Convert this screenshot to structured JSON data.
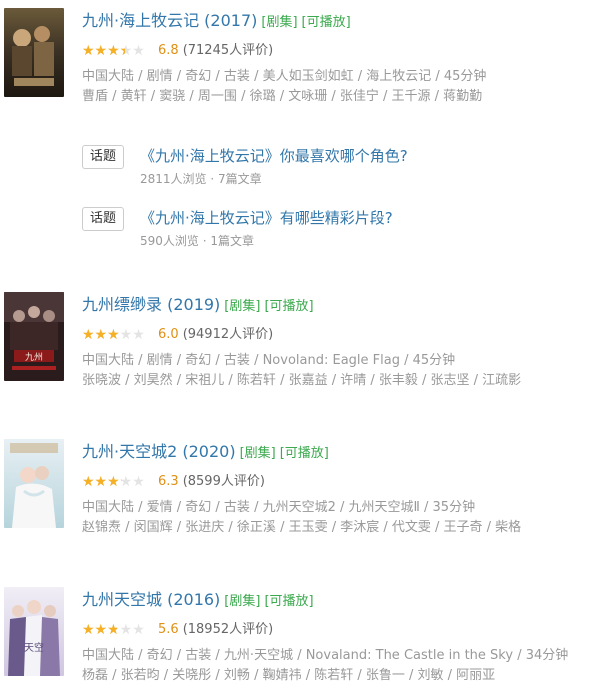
{
  "colors": {
    "link": "#3377aa",
    "tag_green": "#3ba94d",
    "star_gold": "#f5b025",
    "score_orange": "#e09015",
    "meta_gray": "#999999"
  },
  "items": [
    {
      "title": "九州·海上牧云记 (2017)",
      "tags": [
        "[剧集]",
        "[可播放]"
      ],
      "rating_fraction": 0.68,
      "score": "6.8",
      "votes": "(71245人评价)",
      "meta1": "中国大陆 / 剧情 / 奇幻 / 古装 / 美人如玉剑如虹 / 海上牧云记 / 45分钟",
      "meta2": "曹盾 / 黄轩 / 窦骁 / 周一围 / 徐璐 / 文咏珊 / 张佳宁 / 王千源 / 蒋勤勤",
      "topics": [
        {
          "button": "话题",
          "title": "《九州·海上牧云记》你最喜欢哪个角色?",
          "sub": "2811人浏览 · 7篇文章"
        },
        {
          "button": "话题",
          "title": "《九州·海上牧云记》有哪些精彩片段?",
          "sub": "590人浏览 · 1篇文章"
        }
      ]
    },
    {
      "title": "九州缥缈录 (2019)",
      "tags": [
        "[剧集]",
        "[可播放]"
      ],
      "rating_fraction": 0.6,
      "score": "6.0",
      "votes": "(94912人评价)",
      "meta1": "中国大陆 / 剧情 / 奇幻 / 古装 / Novoland: Eagle Flag / 45分钟",
      "meta2": "张晓波 / 刘昊然 / 宋祖儿 / 陈若轩 / 张嘉益 / 许晴 / 张丰毅 / 张志坚 / 江疏影"
    },
    {
      "title": "九州·天空城2 (2020)",
      "tags": [
        "[剧集]",
        "[可播放]"
      ],
      "rating_fraction": 0.63,
      "score": "6.3",
      "votes": "(8599人评价)",
      "meta1": "中国大陆 / 爱情 / 奇幻 / 古装 / 九州天空城2 / 九州天空城Ⅱ / 35分钟",
      "meta2": "赵锦焘 / 闵国辉 / 张进庆 / 徐正溪 / 王玉雯 / 李沐宸 / 代文雯 / 王子奇 / 柴格"
    },
    {
      "title": "九州天空城 (2016)",
      "tags": [
        "[剧集]",
        "[可播放]"
      ],
      "rating_fraction": 0.56,
      "score": "5.6",
      "votes": "(18952人评价)",
      "meta1": "中国大陆 / 奇幻 / 古装 / 九州·天空城 / Novaland: The Castle in the Sky / 34分钟",
      "meta2": "杨磊 / 张若昀 / 关晓彤 / 刘畅 / 鞠婧祎 / 陈若轩 / 张鲁一 / 刘敏 / 阿丽亚"
    }
  ]
}
